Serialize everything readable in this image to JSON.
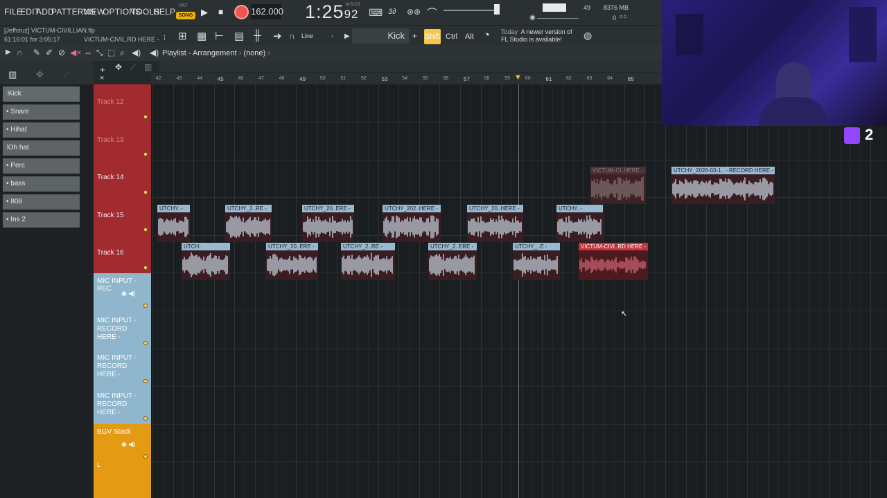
{
  "menu": [
    "FILE",
    "EDIT",
    "ADD",
    "PATTERNS",
    "VIEW",
    "OPTIONS",
    "TOOLS",
    "HELP"
  ],
  "transport": {
    "pat_label": "PAT",
    "song_label": "SONG",
    "tempo": "162.000",
    "time_main": "1:25",
    "time_sub": "92",
    "time_unit": "M:S:CS"
  },
  "stats": {
    "cpu_value": "49",
    "memory": "8376 MB",
    "voices": "0"
  },
  "project": {
    "user_file": "[Jeffcruz]  VICTUM-CIVILLIAN.flp",
    "time_info": "61:16:01 for 3:05:17",
    "hint_clip": "VICTUM-CIVIL.RD HERE -"
  },
  "toolbar": {
    "snap": "Line",
    "pattern": "Kick",
    "shift": "Shift",
    "ctrl": "Ctrl",
    "alt": "Alt",
    "news_today": "Today",
    "news_line1": "A newer version of",
    "news_line2": "FL Studio is available!"
  },
  "playlist": {
    "title": "Playlist - Arrangement",
    "sep": "›",
    "pattern_sel": "(none)"
  },
  "channels": [
    "Kick",
    "Snare",
    "Hihat",
    "Oh hat",
    "Perc",
    "bass",
    "808",
    "Ins 2"
  ],
  "ruler": {
    "ticks": [
      "42",
      "43",
      "44",
      "45",
      "46",
      "47",
      "48",
      "49",
      "50",
      "51",
      "52",
      "53",
      "54",
      "55",
      "56",
      "57",
      "58",
      "59",
      "60",
      "61",
      "62",
      "63",
      "64",
      "65"
    ],
    "major": [
      "45",
      "49",
      "53",
      "57",
      "61",
      "65"
    ]
  },
  "tracks": [
    {
      "name": "Track 12",
      "type": "red",
      "dim": true
    },
    {
      "name": "Track 13",
      "type": "red",
      "dim": true
    },
    {
      "name": "Track 14",
      "type": "red",
      "dim": false
    },
    {
      "name": "Track 15",
      "type": "red",
      "dim": false
    },
    {
      "name": "Track 16",
      "type": "red",
      "dim": false
    },
    {
      "name": "MIC INPUT - REC",
      "type": "blue",
      "dim": false
    },
    {
      "name": "MIC INPUT - RECORD HERE -",
      "type": "blue",
      "dim": false
    },
    {
      "name": "MIC INPUT - RECORD HERE -",
      "type": "blue",
      "dim": false
    },
    {
      "name": "MIC INPUT - RECORD HERE -",
      "type": "blue",
      "dim": false
    },
    {
      "name": "BGV Stack",
      "type": "orange",
      "dim": false
    }
  ],
  "bgv_extra": "L",
  "clips": {
    "track14": [
      {
        "label": "VICTUM-CI..HERE -",
        "style": "muted"
      },
      {
        "label": "UTCHY_2026-03-1.. - RECORD HERE -",
        "style": "blue"
      }
    ],
    "track15": [
      {
        "label": "UTCHY..-",
        "style": "blue"
      },
      {
        "label": "UTCHY_2..RE -",
        "style": "blue"
      },
      {
        "label": "UTCHY_20..ERE -",
        "style": "blue"
      },
      {
        "label": "UTCHY_202..HERE -",
        "style": "blue"
      },
      {
        "label": "UTCHY_20..HERE -",
        "style": "blue"
      },
      {
        "label": "UTCHY..-",
        "style": "blue"
      }
    ],
    "track16": [
      {
        "label": "UTCH..",
        "style": "blue"
      },
      {
        "label": "UTCHY_20..ERE -",
        "style": "blue"
      },
      {
        "label": "UTCHY_2..RE -",
        "style": "blue"
      },
      {
        "label": "UTCHY_2..ERE -",
        "style": "blue"
      },
      {
        "label": "UTCHY_..E -",
        "style": "blue"
      },
      {
        "label": "VICTUM-CIVI..RD HERE -",
        "style": "red"
      }
    ]
  },
  "overlay": {
    "viewers": "2"
  },
  "colors": {
    "accent_yellow": "#f0b400",
    "record_red": "#f0554e",
    "track_red": "#a12b2f",
    "track_blue": "#8fb6cc",
    "track_orange": "#e59a14",
    "clip_cap_blue": "#97b9d2",
    "twitch": "#9146ff"
  }
}
